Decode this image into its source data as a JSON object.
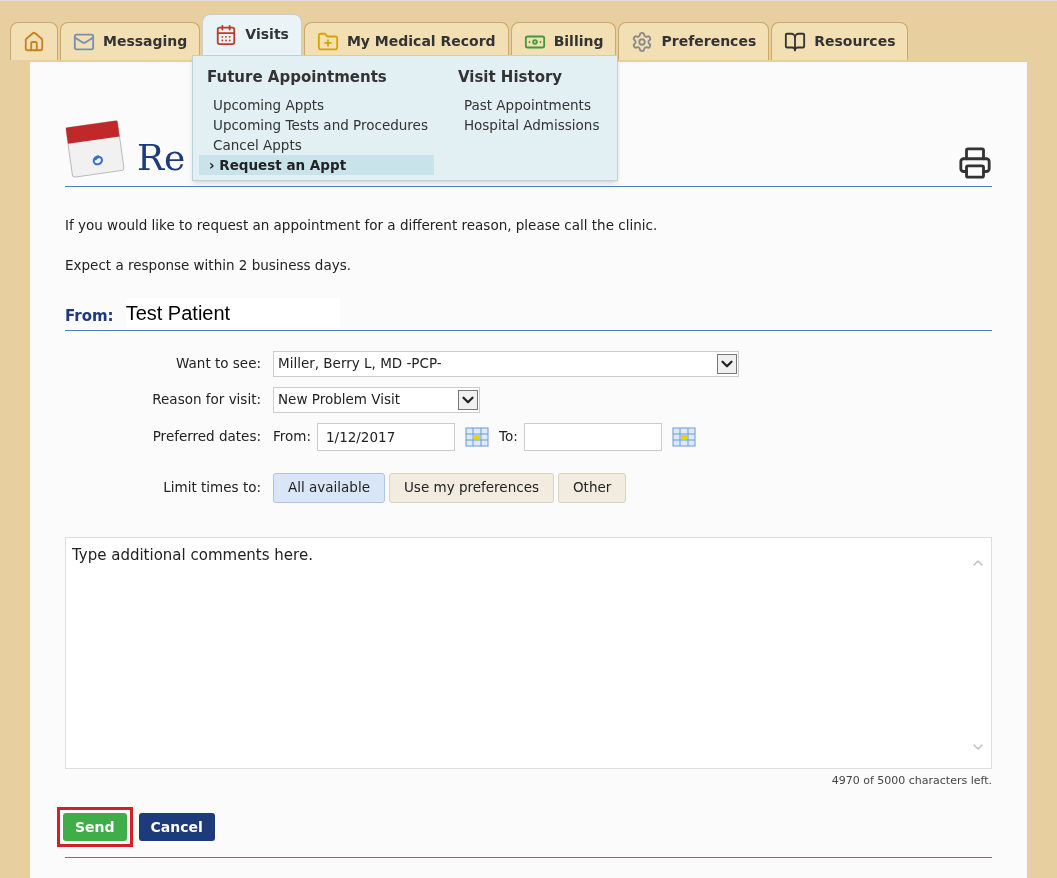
{
  "tabs": [
    {
      "kind": "home",
      "selected": false
    },
    {
      "kind": "messaging",
      "label": "Messaging",
      "selected": false
    },
    {
      "kind": "visits",
      "label": "Visits",
      "selected": true
    },
    {
      "kind": "record",
      "label": "My Medical Record",
      "selected": false
    },
    {
      "kind": "billing",
      "label": "Billing",
      "selected": false
    },
    {
      "kind": "preferences",
      "label": "Preferences",
      "selected": false
    },
    {
      "kind": "resources",
      "label": "Resources",
      "selected": false
    }
  ],
  "menu": {
    "columns": [
      {
        "heading": "Future Appointments",
        "items": [
          {
            "label": "Upcoming Appts",
            "selected": false
          },
          {
            "label": "Upcoming Tests and Procedures",
            "selected": false
          },
          {
            "label": "Cancel Appts",
            "selected": false
          },
          {
            "label": "› Request an Appt",
            "selected": true
          }
        ]
      },
      {
        "heading": "Visit History",
        "items": [
          {
            "label": "Past Appointments",
            "selected": false
          },
          {
            "label": "Hospital Admissions",
            "selected": false
          }
        ]
      }
    ]
  },
  "page_title": "Re",
  "intro": [
    "If you would like to request an appointment for a different reason, please call the clinic.",
    "Expect a response within 2 business days."
  ],
  "from": {
    "label": "From:",
    "value": "Test Patient"
  },
  "form": {
    "want_to_see": {
      "label": "Want to see:",
      "value": "Miller, Berry L, MD -PCP-"
    },
    "reason": {
      "label": "Reason for visit:",
      "value": "New Problem Visit"
    },
    "dates": {
      "label": "Preferred dates:",
      "from_label": "From:",
      "from_value": "1/12/2017",
      "to_label": "To:"
    },
    "limit": {
      "label": "Limit times to:",
      "options": [
        {
          "label": "All available",
          "selected": true
        },
        {
          "label": "Use my preferences",
          "selected": false
        },
        {
          "label": "Other",
          "selected": false
        }
      ]
    }
  },
  "comments": {
    "value": "Type additional comments here.",
    "counter": "4970 of 5000 characters left."
  },
  "buttons": [
    {
      "kind": "send",
      "label": "Send"
    },
    {
      "kind": "cancel",
      "label": "Cancel"
    }
  ]
}
